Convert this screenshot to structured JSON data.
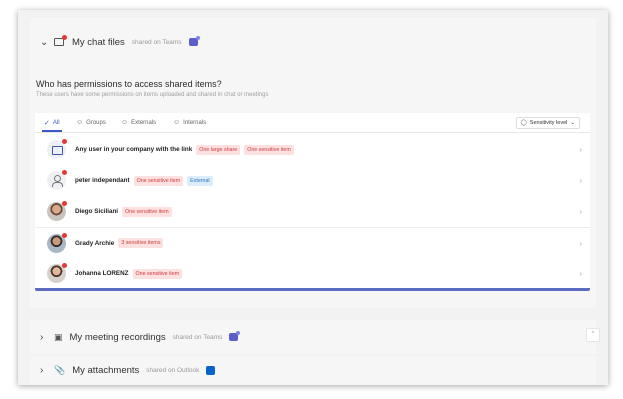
{
  "chat_files": {
    "title": "My chat files",
    "subtitle": "shared on Teams",
    "permissions_title": "Who has permissions to access shared items?",
    "permissions_subtitle": "These users have some permissions on items uploaded and shared in chat or meetings",
    "tabs": [
      {
        "label": "All",
        "icon": "check-shield-icon",
        "active": true
      },
      {
        "label": "Groups",
        "icon": "groups-icon",
        "active": false
      },
      {
        "label": "Externals",
        "icon": "externals-icon",
        "active": false
      },
      {
        "label": "Internals",
        "icon": "internals-icon",
        "active": false
      }
    ],
    "sensitivity_label": "Sensitivity level",
    "rows": [
      {
        "name": "Any user in your company with the link",
        "badges": [
          {
            "text": "One large share",
            "color": "red"
          },
          {
            "text": "One sensitive item",
            "color": "red"
          }
        ]
      },
      {
        "name": "peter independant",
        "badges": [
          {
            "text": "One sensitive item",
            "color": "red"
          },
          {
            "text": "External",
            "color": "blue"
          }
        ]
      },
      {
        "name": "Diego Siciliani",
        "badges": [
          {
            "text": "One sensitive item",
            "color": "red"
          }
        ]
      },
      {
        "name": "Grady Archie",
        "badges": [
          {
            "text": "3 sensitive items",
            "color": "red"
          }
        ]
      },
      {
        "name": "Johanna LORENZ",
        "badges": [
          {
            "text": "One sensitive item",
            "color": "red"
          }
        ]
      }
    ]
  },
  "meeting_recordings": {
    "title": "My meeting recordings",
    "subtitle": "shared on Teams"
  },
  "attachments": {
    "title": "My attachments",
    "subtitle": "shared on Outlook"
  },
  "colors": {
    "accent": "#3a59c7",
    "alert_red": "#e53935",
    "badge_red_bg": "#fde0e0",
    "badge_blue_bg": "#dcecfb"
  }
}
